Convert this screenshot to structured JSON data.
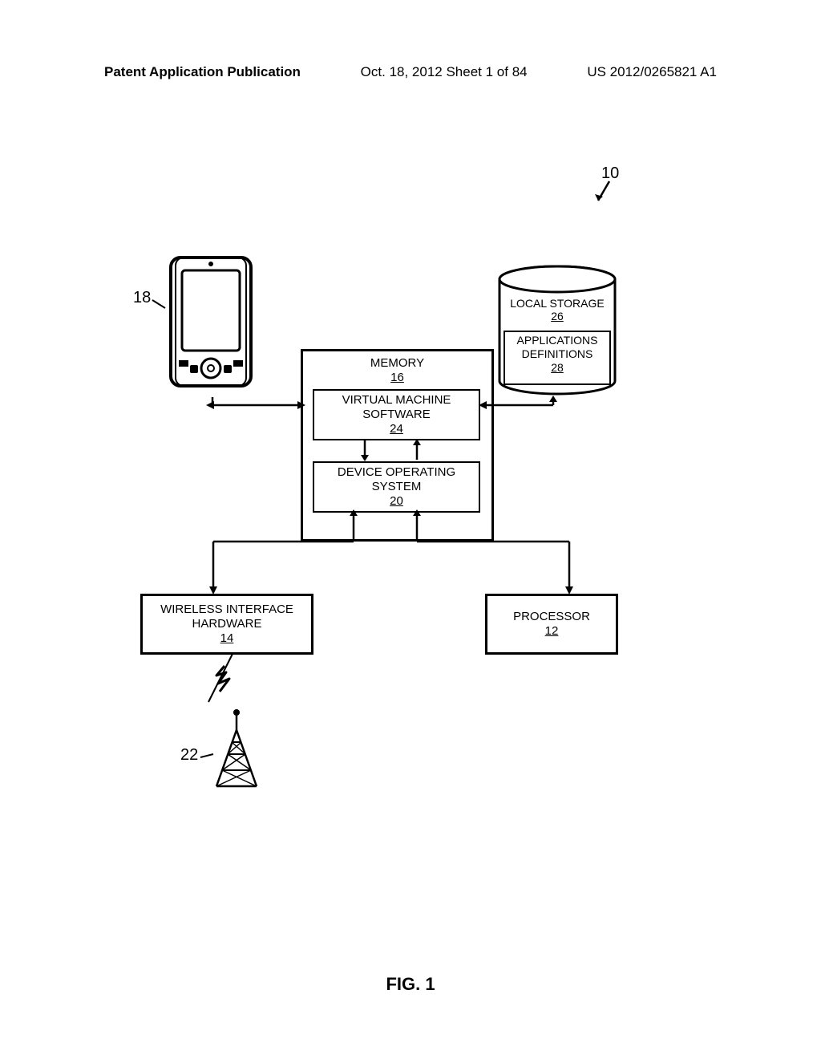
{
  "header": {
    "left": "Patent Application Publication",
    "center": "Oct. 18, 2012  Sheet 1 of 84",
    "right": "US 2012/0265821 A1"
  },
  "labels": {
    "ref10": "10",
    "ref18": "18",
    "ref22": "22"
  },
  "memory": {
    "title": "MEMORY",
    "num": "16"
  },
  "vm": {
    "l1": "VIRTUAL MACHINE",
    "l2": "SOFTWARE",
    "num": "24"
  },
  "os": {
    "l1": "DEVICE OPERATING",
    "l2": "SYSTEM",
    "num": "20"
  },
  "wireless": {
    "l1": "WIRELESS INTERFACE",
    "l2": "HARDWARE",
    "num": "14"
  },
  "processor": {
    "l1": "PROCESSOR",
    "num": "12"
  },
  "storage": {
    "l1": "LOCAL STORAGE",
    "num": "26"
  },
  "appdefs": {
    "l1": "APPLICATIONS",
    "l2": "DEFINITIONS",
    "num": "28"
  },
  "caption": "FIG. 1"
}
